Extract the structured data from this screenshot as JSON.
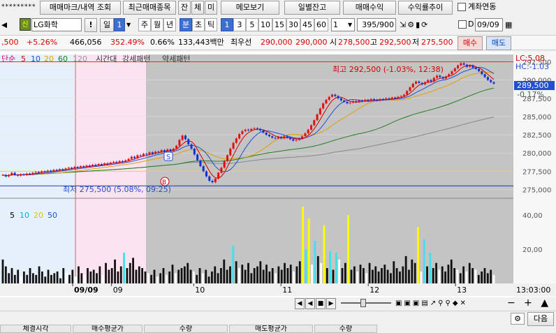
{
  "toolbar1": {
    "password": "*********",
    "trade_mark_btn": "매매마크/내역 조회",
    "recent_trade_btn": "최근매매종목",
    "jan": "잔",
    "che": "체",
    "mi": "미",
    "memo_btn": "메모보기",
    "daily_balance_btn": "일별잔고",
    "trade_profit_btn": "매매수익",
    "return_trend_btn": "수익률추이",
    "account_link_label": "계좌연동"
  },
  "toolbar2": {
    "credit_badge": "신",
    "stock_name": "LG화학",
    "excl": "!",
    "period_day": "일",
    "period_num": "1",
    "week": "주",
    "month": "월",
    "year": "년",
    "minute": "분",
    "second": "초",
    "tick": "틱",
    "intervals": [
      "1",
      "3",
      "5",
      "10",
      "15",
      "30",
      "45",
      "60"
    ],
    "interval_select": "1",
    "count": "395/900",
    "d_label": "D",
    "date_value": "09/09"
  },
  "infobar": {
    "c1": ",500",
    "c2": "+5.26%",
    "c3": "466,056",
    "c4": "352.49%",
    "c5": "0.66%",
    "c6": "133,443백만",
    "c7": "최우선",
    "c8": "290,000",
    "c9": "290,000",
    "c10": "시",
    "c11": "278,500",
    "c12": "고",
    "c13": "292,500",
    "c14": "저",
    "c15": "275,500",
    "buy": "매수",
    "sell": "매도"
  },
  "chart_data": {
    "type": "candlestick",
    "legend": {
      "label": "단순",
      "ma": [
        "5",
        "10",
        "20",
        "60",
        "120"
      ],
      "extras": [
        "시간대",
        "강세패턴",
        "약세패턴"
      ]
    },
    "volume_legend": [
      "5",
      "10",
      "20",
      "50"
    ],
    "lc": "LC:5.08",
    "hc": "HC:-1.03",
    "high_annotation": "최고 292,500 (-1.03%, 12:38)",
    "low_annotation": "최저 275,500 (5.08%, 09:25)",
    "current_price": "289,500",
    "current_change": "-0.17%",
    "ylim": [
      274000,
      293500
    ],
    "y_ticks": [
      {
        "v": 292500,
        "label": "292,500"
      },
      {
        "v": 290000,
        "label": "290,000"
      },
      {
        "v": 287500,
        "label": "287,500"
      },
      {
        "v": 285000,
        "label": "285,000"
      },
      {
        "v": 282500,
        "label": "282,500"
      },
      {
        "v": 280000,
        "label": "280,000"
      },
      {
        "v": 277500,
        "label": "277,500"
      },
      {
        "v": 275000,
        "label": "275,000"
      }
    ],
    "high_line": 292500,
    "low_line": 275500,
    "ref_line": 277500,
    "x_labels": [
      {
        "f": 0.015,
        "label": "09/09",
        "bold": true
      },
      {
        "f": 0.22,
        "label": "09"
      },
      {
        "f": 0.38,
        "label": "10"
      },
      {
        "f": 0.55,
        "label": "11"
      },
      {
        "f": 0.72,
        "label": "12"
      },
      {
        "f": 0.89,
        "label": "13"
      }
    ],
    "time_axis_label": "13:03:00",
    "volume_ticks": [
      {
        "v": 40,
        "label": "40,00"
      },
      {
        "v": 20,
        "label": "20,00"
      }
    ],
    "volume_max": 45,
    "closes": [
      277000,
      276800,
      277000,
      277300,
      277000,
      276900,
      277100,
      277000,
      277200,
      277100,
      277300,
      277400,
      277300,
      277500,
      277400,
      277600,
      277500,
      277700,
      277600,
      277800,
      277700,
      277900,
      278000,
      277900,
      278100,
      278000,
      278200,
      278100,
      278300,
      278200,
      278400,
      278300,
      278500,
      278400,
      278600,
      278500,
      278700,
      278800,
      278700,
      278900,
      278800,
      279000,
      279200,
      279500,
      279300,
      279700,
      279600,
      279900,
      279800,
      280100,
      279900,
      280200,
      280100,
      280400,
      280200,
      280500,
      280300,
      280600,
      281000,
      281800,
      282400,
      281900,
      281200,
      280600,
      279800,
      279000,
      278200,
      277500,
      276800,
      276200,
      276000,
      276500,
      277300,
      278000,
      278900,
      279700,
      280600,
      281400,
      282000,
      282600,
      283000,
      283200,
      283100,
      283300,
      283400,
      283300,
      283100,
      282800,
      282500,
      282300,
      282100,
      282000,
      282200,
      282000,
      282300,
      282100,
      281900,
      281700,
      281800,
      282000,
      282300,
      282700,
      283200,
      283800,
      284500,
      285300,
      286100,
      286800,
      287300,
      287700,
      288000,
      287800,
      287500,
      287200,
      287000,
      286800,
      286900,
      287100,
      287000,
      287200,
      287100,
      287300,
      287200,
      287400,
      287300,
      287200,
      287400,
      287300,
      287500,
      287400,
      287600,
      287500,
      287700,
      287800,
      288000,
      288500,
      289000,
      289500,
      289800,
      289600,
      289400,
      289700,
      290000,
      289800,
      290300,
      290600,
      290400,
      290200,
      290500,
      290800,
      291200,
      291600,
      292000,
      292300,
      292100,
      291800,
      292000,
      291700,
      291500,
      291200,
      290800,
      290400,
      290000,
      289700,
      289500
    ],
    "volumes": [
      14,
      10,
      6,
      9,
      5,
      8,
      4,
      7,
      5,
      9,
      6,
      5,
      10,
      7,
      4,
      8,
      5,
      6,
      7,
      3,
      9,
      6,
      5,
      8,
      4,
      10,
      6,
      5,
      9,
      7,
      8,
      6,
      10,
      5,
      12,
      8,
      9,
      14,
      7,
      10,
      18,
      9,
      12,
      15,
      8,
      10,
      9,
      7,
      6,
      5,
      8,
      4,
      6,
      9,
      5,
      7,
      11,
      6,
      8,
      9,
      10,
      12,
      8,
      7,
      5,
      9,
      6,
      8,
      4,
      7,
      10,
      6,
      9,
      14,
      8,
      10,
      22,
      13,
      9,
      11,
      8,
      12,
      6,
      9,
      10,
      13,
      8,
      11,
      7,
      9,
      6,
      10,
      8,
      12,
      9,
      11,
      7,
      10,
      13,
      45,
      20,
      38,
      11,
      25,
      16,
      12,
      34,
      9,
      19,
      8,
      18,
      14,
      9,
      12,
      40,
      8,
      10,
      7,
      11,
      9,
      6,
      12,
      8,
      10,
      7,
      9,
      11,
      8,
      6,
      13,
      9,
      7,
      10,
      16,
      8,
      14,
      12,
      33,
      7,
      26,
      10,
      18,
      9,
      12,
      8,
      10,
      7,
      11,
      14,
      9,
      8,
      6,
      10,
      7,
      12,
      9,
      8,
      5,
      7,
      9,
      6,
      8,
      5
    ]
  },
  "footer": {
    "columns": [
      "체결시각",
      "매수평균가",
      "수량",
      "매도평균가",
      "수량"
    ],
    "next_btn": "다음"
  }
}
